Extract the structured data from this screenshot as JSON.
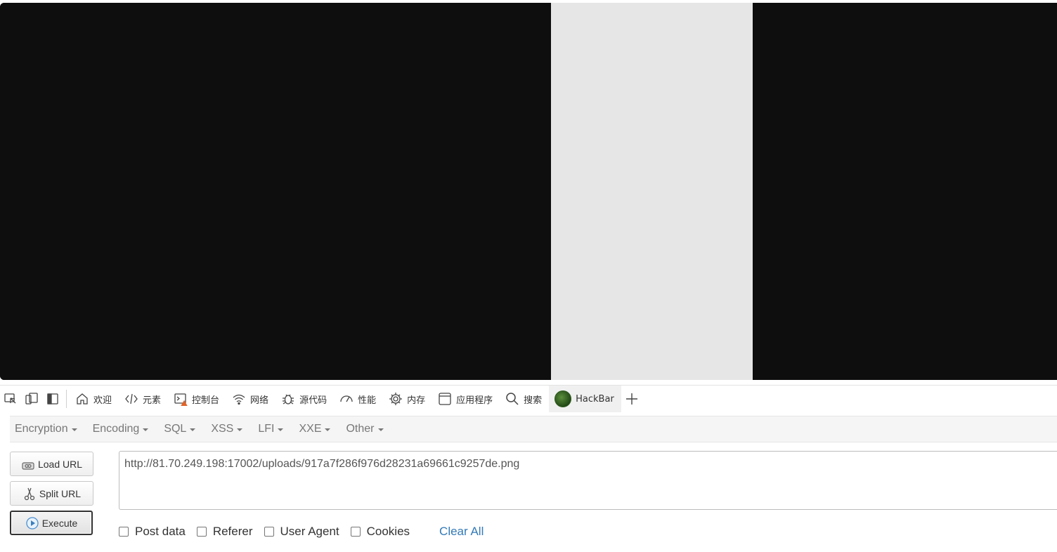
{
  "viewport": {
    "colors": {
      "dark": "#0e0e0e",
      "light": "#e6e6e6"
    }
  },
  "devtools": {
    "tool_icons": [
      "inspect-icon",
      "device-emulation-icon",
      "dock-side-icon"
    ],
    "tabs": [
      {
        "label": "欢迎",
        "icon": "home-icon"
      },
      {
        "label": "元素",
        "icon": "code-icon"
      },
      {
        "label": "控制台",
        "icon": "console-icon"
      },
      {
        "label": "网络",
        "icon": "wifi-icon"
      },
      {
        "label": "源代码",
        "icon": "bug-icon"
      },
      {
        "label": "性能",
        "icon": "gauge-icon"
      },
      {
        "label": "内存",
        "icon": "chip-icon"
      },
      {
        "label": "应用程序",
        "icon": "window-icon"
      },
      {
        "label": "搜索",
        "icon": "search-icon"
      },
      {
        "label": "HackBar",
        "icon": "hackbar-logo-icon",
        "active": true
      }
    ]
  },
  "hackbar": {
    "menus": [
      "Encryption",
      "Encoding",
      "SQL",
      "XSS",
      "LFI",
      "XXE",
      "Other"
    ],
    "buttons": {
      "load": "Load URL",
      "split": "Split URL",
      "execute": "Execute"
    },
    "url": "http://81.70.249.198:17002/uploads/917a7f286f976d28231a69661c9257de.png",
    "options": {
      "post_data": "Post data",
      "referer": "Referer",
      "user_agent": "User Agent",
      "cookies": "Cookies"
    },
    "clear_all": "Clear All"
  }
}
